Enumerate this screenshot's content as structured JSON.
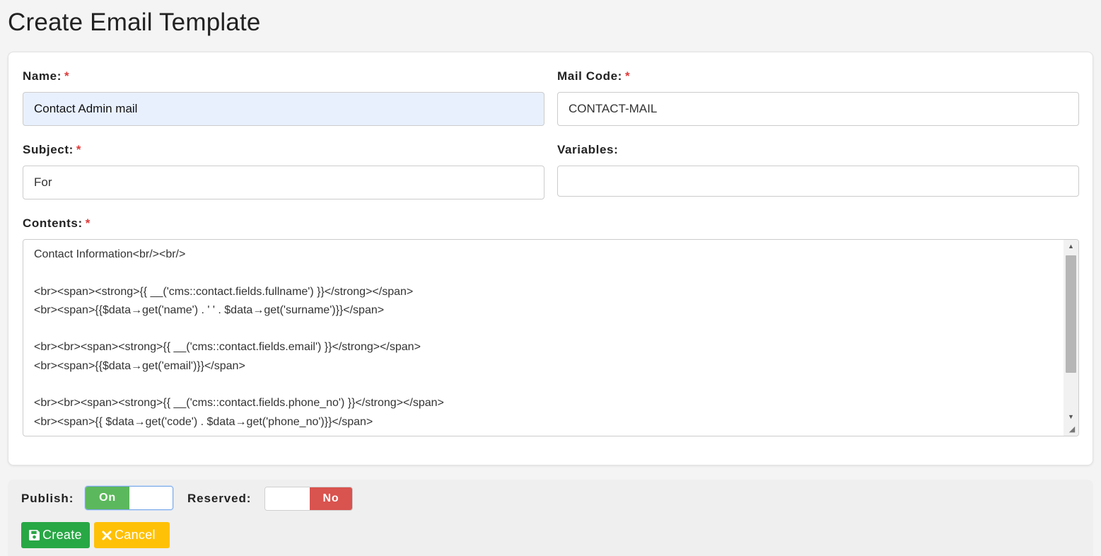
{
  "page": {
    "title": "Create Email Template"
  },
  "form": {
    "name": {
      "label": "Name:",
      "required_mark": "*",
      "value": "Contact Admin mail"
    },
    "mail_code": {
      "label": "Mail Code:",
      "required_mark": "*",
      "value": "CONTACT-MAIL"
    },
    "subject": {
      "label": "Subject:",
      "required_mark": "*",
      "value": "For"
    },
    "variables": {
      "label": "Variables:",
      "value": ""
    },
    "contents": {
      "label": "Contents:",
      "required_mark": "*",
      "lines": [
        "Contact Information<br/><br/>",
        "",
        "<br><span><strong>{{ __('cms::contact.fields.fullname') }}</strong></span>",
        "<br><span>{{$data→get('name') . ' ' . $data→get('surname')}}</span>",
        "",
        "<br><br><span><strong>{{ __('cms::contact.fields.email') }}</strong></span>",
        "<br><span>{{$data→get('email')}}</span>",
        "",
        "<br><br><span><strong>{{ __('cms::contact.fields.phone_no') }}</strong></span>",
        "<br><span>{{ $data→get('code') . $data→get('phone_no')}}</span>"
      ]
    }
  },
  "footer": {
    "publish": {
      "label": "Publish:",
      "state": "On"
    },
    "reserved": {
      "label": "Reserved:",
      "state": "No"
    },
    "create_label": "Create",
    "cancel_label": "Cancel"
  },
  "colors": {
    "toggle_on": "#5cb85c",
    "toggle_no": "#d9534f",
    "create_button": "#28a745",
    "cancel_button": "#ffc107",
    "required": "#e03a3a",
    "autofill": "#e8f0fe"
  },
  "icons": {
    "create": "save-icon",
    "cancel": "close-icon",
    "resize": "resize-grip-icon"
  }
}
